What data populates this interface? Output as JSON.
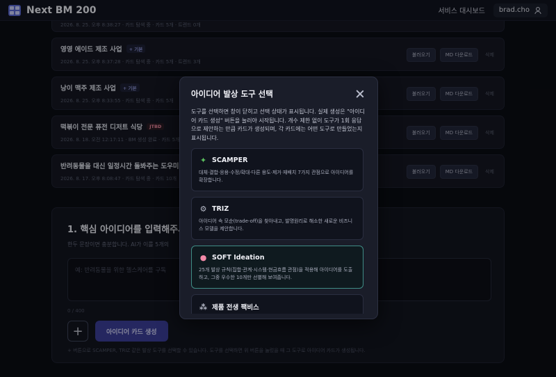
{
  "app": {
    "title": "Next BM 200"
  },
  "header": {
    "dashboard": "서비스 대시보드",
    "username": "brad.cho"
  },
  "history": [
    {
      "title": "",
      "tag": "",
      "meta": "2026. 8. 25. 오후 8:38:27 · 카드 탐색 중 · 카드 5개 · 트렌드 0개"
    },
    {
      "title": "영영 에이드 제조 사업",
      "tag": "+ 기본",
      "meta": "2026. 8. 25. 오후 8:37:28 · 카드 탐색 중 · 카드 5개 · 트렌드 3개"
    },
    {
      "title": "낭이 맥주 제조 사업",
      "tag": "+ 기본",
      "meta": "2026. 8. 25. 오후 8:33:55 · 카드 탐색 중 · 카드 5개"
    },
    {
      "title": "떡볶이 전문 퓨전 디저트 식당",
      "tag": "JTBD",
      "meta": "2026. 8. 18. 오전 12:17:11 · BM 생성 완료 · 카드 5개"
    },
    {
      "title": "반려동물을 대신 일정시간 돌봐주는 도우미 파견",
      "tag": "",
      "meta": "2026. 8. 17. 오후 8:08:47 · 카드 탐색 중 · 카드 10개"
    }
  ],
  "row_actions": {
    "load": "불러오기",
    "md": "MD 다운로드",
    "delete": "삭제"
  },
  "input_panel": {
    "title": "1. 핵심 아이디어를 입력해주세요",
    "subtitle": "한두 문장이면 충분합니다. AI가 이를 5개의",
    "placeholder": "예: 반려동물을 위한 헬스케어를 구독",
    "count": "0 / 400",
    "plus": "+",
    "generate": "아이디어 카드 생성",
    "hint": "+ 버튼으로 SCAMPER, TRIZ 같은 발상 도구를 선택할 수 있습니다. 도구를 선택하면 위 버튼을 눌렀을 때 그 도구로 아이디어 카드가 생성됩니다."
  },
  "modal": {
    "title": "아이디어 발상 도구 선택",
    "description": "도구를 선택하면 창이 닫히고 선택 상태가 표시됩니다. 실제 생성은 \"아이디어 카드 생성\" 버튼을 눌러야 시작됩니다. 개수 제한 없이 도구가 1회 응답으로 제안하는 만큼 카드가 생성되며, 각 카드에는 어떤 도구로 만들었는지 표시됩니다.",
    "tools": [
      {
        "name": "SCAMPER",
        "icon": "puzzle-icon",
        "color": "#4caf50",
        "desc": "대체·결합·응용·수정/확대·다른 용도·제거·재배치 7가지 관점으로 아이디어를 확장합니다."
      },
      {
        "name": "TRIZ",
        "icon": "gear-icon",
        "color": "#9aa0b0",
        "desc": "아이디어 속 모순(trade-off)을 찾아내고, 발명원리로 해소한 새로운 비즈니스 모델을 제안합니다."
      },
      {
        "name": "SOFT Ideation",
        "icon": "brain-icon",
        "color": "#f28aa8",
        "desc": "25개 발상 규칙(집합·관계·시스템·현금흐름 관점)을 적용해 아이디어를 도출하고, 그중 우수한 10개만 선별해 보여줍니다."
      },
      {
        "name": "제품 전생 팩비스",
        "icon": "dots-icon",
        "color": "#9aa0b0",
        "desc": ""
      }
    ]
  }
}
